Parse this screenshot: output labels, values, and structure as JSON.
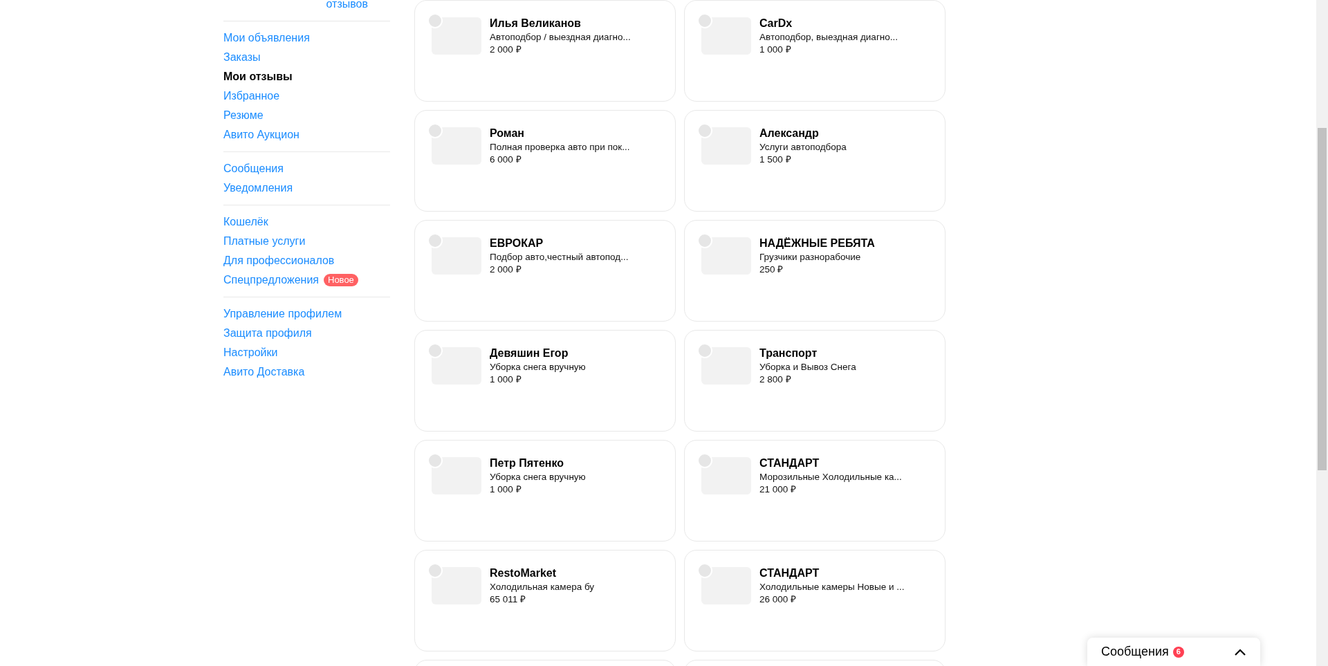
{
  "sidebar": {
    "reviews_link": "отзывов",
    "groups": [
      [
        {
          "label": "Мои объявления",
          "selected": false
        },
        {
          "label": "Заказы",
          "selected": false
        },
        {
          "label": "Мои отзывы",
          "selected": true
        },
        {
          "label": "Избранное",
          "selected": false
        },
        {
          "label": "Резюме",
          "selected": false
        },
        {
          "label": "Авито Аукцион",
          "selected": false
        }
      ],
      [
        {
          "label": "Сообщения",
          "selected": false
        },
        {
          "label": "Уведомления",
          "selected": false
        }
      ],
      [
        {
          "label": "Кошелёк",
          "selected": false
        },
        {
          "label": "Платные услуги",
          "selected": false
        },
        {
          "label": "Для профессионалов",
          "selected": false
        },
        {
          "label": "Спецпредложения",
          "selected": false,
          "badge": "Новое"
        }
      ],
      [
        {
          "label": "Управление профилем",
          "selected": false
        },
        {
          "label": "Защита профиля",
          "selected": false
        },
        {
          "label": "Настройки",
          "selected": false
        },
        {
          "label": "Авито Доставка",
          "selected": false
        }
      ]
    ]
  },
  "cards": [
    {
      "kind": "item",
      "seller": "Илья Великанов",
      "title": "Автоподбор / выездная диагно...",
      "price": "2 000 ₽"
    },
    {
      "kind": "item",
      "seller": "CarDx",
      "title": "Автоподбор, выездная диагно...",
      "price": "1 000 ₽"
    },
    {
      "kind": "item",
      "seller": "Роман",
      "title": "Полная проверка авто при пок...",
      "price": "6 000 ₽"
    },
    {
      "kind": "item",
      "seller": "Александр",
      "title": "Услуги автоподбора",
      "price": "1 500 ₽"
    },
    {
      "kind": "item",
      "seller": "ЕВРОКАР",
      "title": "Подбор авто,честный автопод...",
      "price": "2 000 ₽"
    },
    {
      "kind": "item",
      "seller": "НАДЁЖНЫЕ РЕБЯТА",
      "title": "Грузчики разнорабочие",
      "price": "250 ₽"
    },
    {
      "kind": "item",
      "seller": "Девяшин Егор",
      "title": "Уборка снега вручную",
      "price": "1 000 ₽"
    },
    {
      "kind": "item",
      "seller": "Транспорт",
      "title": "Уборка и Вывоз Снега",
      "price": "2 800 ₽"
    },
    {
      "kind": "item",
      "seller": "Петр Пятенко",
      "title": "Уборка снега вручную",
      "price": "1 000 ₽"
    },
    {
      "kind": "item",
      "seller": "СТАНДАРТ",
      "title": "Морозильные Холодильные ка...",
      "price": "21 000 ₽"
    },
    {
      "kind": "item",
      "seller": "RestoMarket",
      "title": "Холодильная камера бу",
      "price": "65 011 ₽"
    },
    {
      "kind": "item",
      "seller": "СТАНДАРТ",
      "title": "Холодильные камеры Новые и ...",
      "price": "26 000 ₽"
    },
    {
      "kind": "cut"
    },
    {
      "kind": "cut"
    }
  ],
  "messenger": {
    "title": "Сообщения",
    "count": "6"
  }
}
